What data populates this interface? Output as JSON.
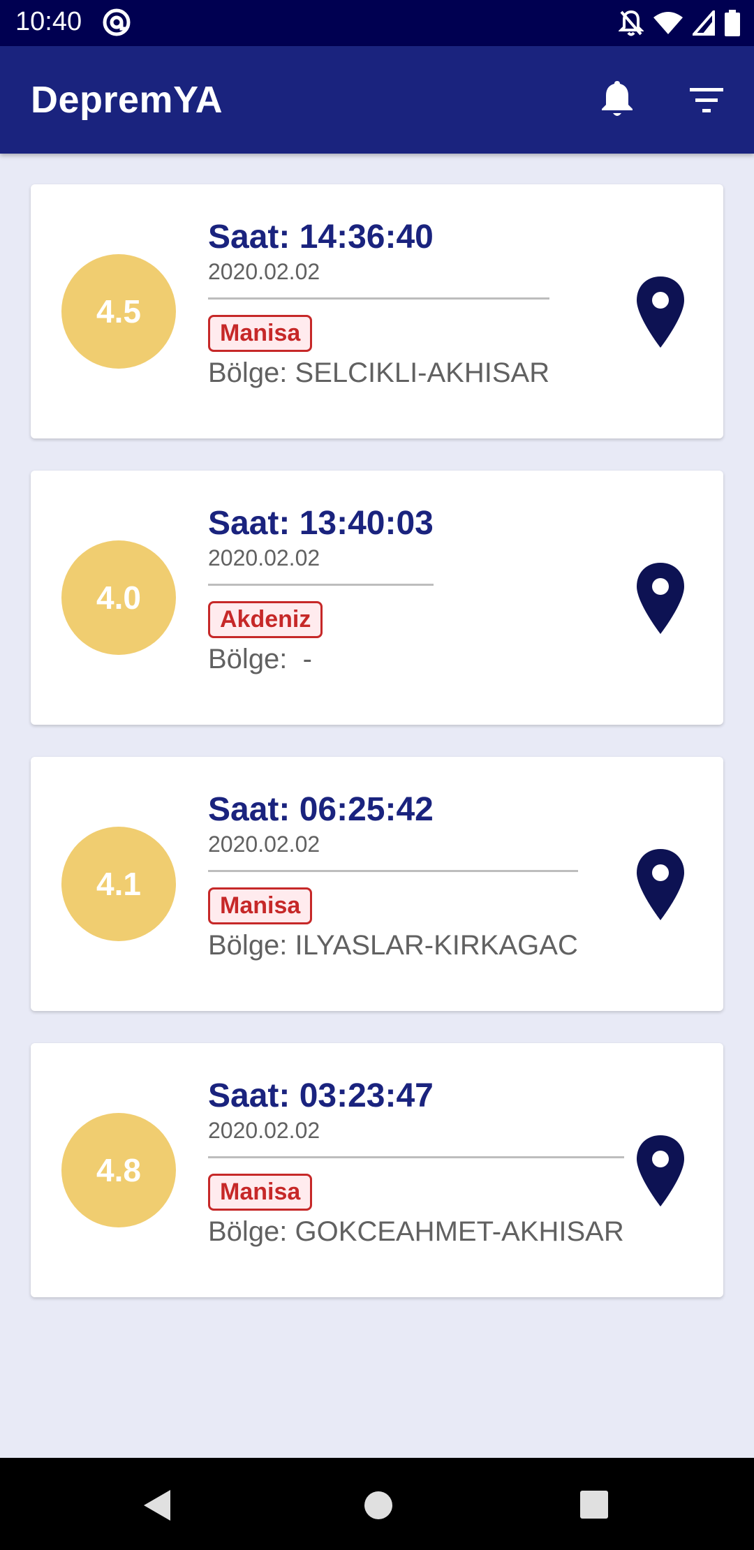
{
  "status_bar": {
    "time": "10:40"
  },
  "app_bar": {
    "title": "DepremYA"
  },
  "earthquakes": [
    {
      "magnitude": "4.5",
      "time_label": "Saat: 14:36:40",
      "date": "2020.02.02",
      "city": "Manisa",
      "region": "Bölge: SELCIKLI-AKHISAR"
    },
    {
      "magnitude": "4.0",
      "time_label": "Saat: 13:40:03",
      "date": "2020.02.02",
      "city": "Akdeniz",
      "region": "Bölge:  -"
    },
    {
      "magnitude": "4.1",
      "time_label": "Saat: 06:25:42",
      "date": "2020.02.02",
      "city": "Manisa",
      "region": "Bölge: ILYASLAR-KIRKAGAC"
    },
    {
      "magnitude": "4.8",
      "time_label": "Saat: 03:23:47",
      "date": "2020.02.02",
      "city": "Manisa",
      "region": "Bölge: GOKCEAHMET-AKHISAR"
    }
  ],
  "icons": {
    "notification": "bell-icon",
    "filter": "filter-icon",
    "location": "map-pin-icon"
  },
  "colors": {
    "app_bar": "#1a237e",
    "status_bar": "#000051",
    "magnitude_badge": "#f0cd70",
    "city_tag": "#c62828",
    "background": "#e8eaf6"
  }
}
